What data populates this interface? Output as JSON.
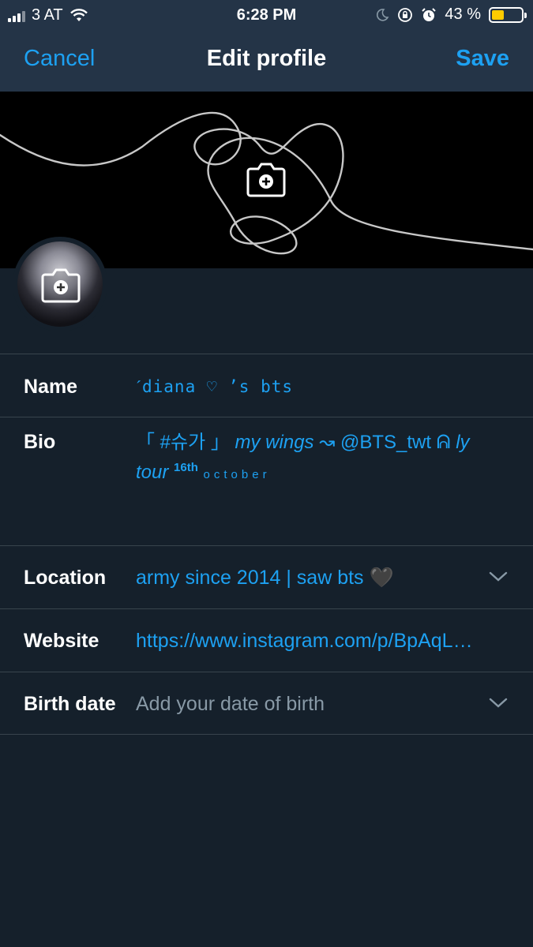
{
  "status": {
    "carrier": "3 AT",
    "time": "6:28 PM",
    "battery_pct": "43 %",
    "battery_level": 0.43,
    "battery_color": "#ffcc00",
    "icons": [
      "signal-icon",
      "wifi-icon",
      "moon-icon",
      "rotation-lock-icon",
      "alarm-icon",
      "battery-icon"
    ]
  },
  "nav": {
    "cancel": "Cancel",
    "title": "Edit profile",
    "save": "Save"
  },
  "header": {
    "banner_icon": "camera-add-icon",
    "avatar_icon": "camera-add-icon"
  },
  "fields": {
    "name": {
      "label": "Name",
      "value": "ˊdiana ♡ ’s bts"
    },
    "bio": {
      "label": "Bio",
      "part1": "「 #슈가 」",
      "part2": "my wings",
      "part3": " ↝ @BTS_twt ᕱ ",
      "part4": "ly tour",
      "part5": "16th",
      "part6": "october"
    },
    "location": {
      "label": "Location",
      "value": "army since 2014 | saw bts  🖤"
    },
    "website": {
      "label": "Website",
      "value": "https://www.instagram.com/p/BpAqL…"
    },
    "birth_date": {
      "label": "Birth date",
      "placeholder": "Add your date of birth"
    }
  },
  "colors": {
    "accent": "#1da1f2",
    "background": "#15202b",
    "nav_background": "#243447",
    "divider": "#38444d",
    "placeholder": "#8899a6"
  }
}
